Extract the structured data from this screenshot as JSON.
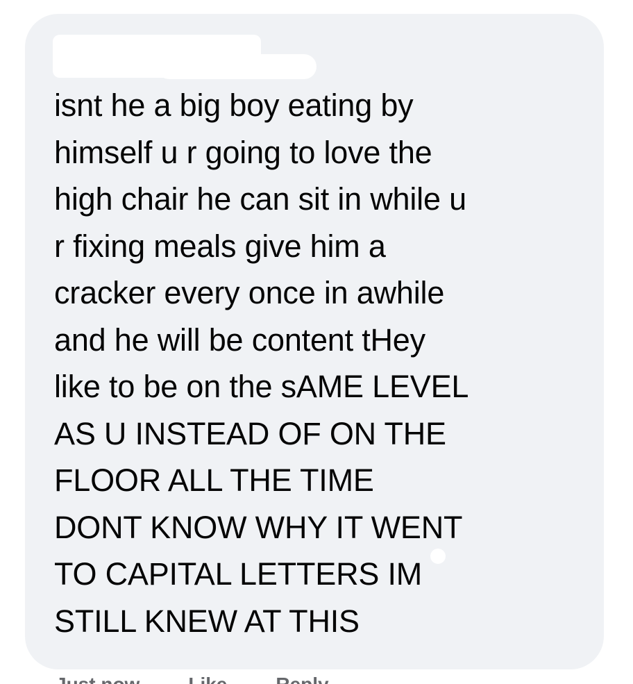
{
  "comment": {
    "author_name": "",
    "text": "isnt he a big boy eating by\nhimself u r going to love the\nhigh chair he can sit in while u\nr fixing meals give him a\ncracker every once in awhile\nand he will be content  tHey\nlike to be on the sAME LEVEL\nAS U INSTEAD OF ON THE\nFLOOR ALL THE TIME\nDONT KNOW WHY IT WENT\nTO CAPITAL LETTERS IM\nSTILL KNEW AT THIS",
    "timestamp": "Just now",
    "like_label": "Like",
    "reply_label": "Reply"
  },
  "colors": {
    "bubble_background": "#f0f2f5",
    "text": "#050505",
    "meta_text": "#65676b",
    "page_background": "#ffffff"
  }
}
